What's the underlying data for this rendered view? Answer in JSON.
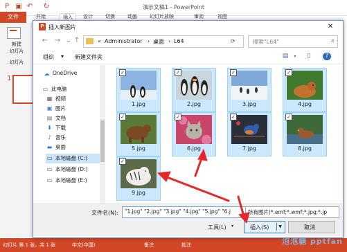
{
  "powerpoint": {
    "window_title": "演示文稿1 - PowerPoint",
    "file_tab": "文件",
    "ribbon_tabs": [
      "开始",
      "插入",
      "设计",
      "切换",
      "动画",
      "幻灯片放映",
      "审阅",
      "视图"
    ],
    "new_slide_label_1": "新建",
    "new_slide_label_2": "幻灯片",
    "slides_label": "幻灯片",
    "slide_number": "1",
    "status_left": "幻灯片 第 1 张，共 1 张",
    "status_lang": "中文(中国)",
    "status_notes": "备注",
    "status_comments": "批注",
    "accent": "#d24726"
  },
  "dialog": {
    "title": "插入新图片",
    "close": "✕",
    "path": {
      "prefix": "«",
      "crumbs": [
        "Administrator",
        "桌面",
        "L64"
      ]
    },
    "search_placeholder": "搜索\"L64\"",
    "organize": "组织",
    "new_folder": "新建文件夹",
    "nav": [
      {
        "label": "OneDrive",
        "icon": "cloud-icon"
      },
      {
        "label": "此电脑",
        "icon": "computer-icon"
      },
      {
        "label": "视频",
        "icon": "video-icon"
      },
      {
        "label": "图片",
        "icon": "picture-icon"
      },
      {
        "label": "文档",
        "icon": "document-icon"
      },
      {
        "label": "下载",
        "icon": "download-icon"
      },
      {
        "label": "音乐",
        "icon": "music-icon"
      },
      {
        "label": "桌面",
        "icon": "desktop-icon"
      },
      {
        "label": "本地磁盘 (C:)",
        "icon": "drive-icon"
      },
      {
        "label": "本地磁盘 (D:)",
        "icon": "drive-icon"
      },
      {
        "label": "本地磁盘 (E:)",
        "icon": "drive-icon"
      }
    ],
    "files": [
      {
        "name": "1.jpg",
        "checked": true
      },
      {
        "name": "2.jpg",
        "checked": true
      },
      {
        "name": "3.jpg",
        "checked": true
      },
      {
        "name": "4.jpg",
        "checked": true
      },
      {
        "name": "5.jpg",
        "checked": true
      },
      {
        "name": "6.jpg",
        "checked": true
      },
      {
        "name": "7.jpg",
        "checked": true
      },
      {
        "name": "8.jpg",
        "checked": true
      },
      {
        "name": "9.jpg",
        "checked": true
      }
    ],
    "filename_label": "文件名(N):",
    "filename_value": "\"1.jpg\" \"2.jpg\" \"3.jpg\" \"4.jpg\" \"5.jpg\" \"6.j",
    "filter_value": "所有图片(*.emf;*.wmf;*.jpg;*.jp",
    "tools": "工具(L)",
    "insert": "插入(S)",
    "cancel": "取消"
  },
  "watermark": "泡泡糖 pptfan",
  "check_mark": "✓",
  "arrow_color": "#e8272b"
}
